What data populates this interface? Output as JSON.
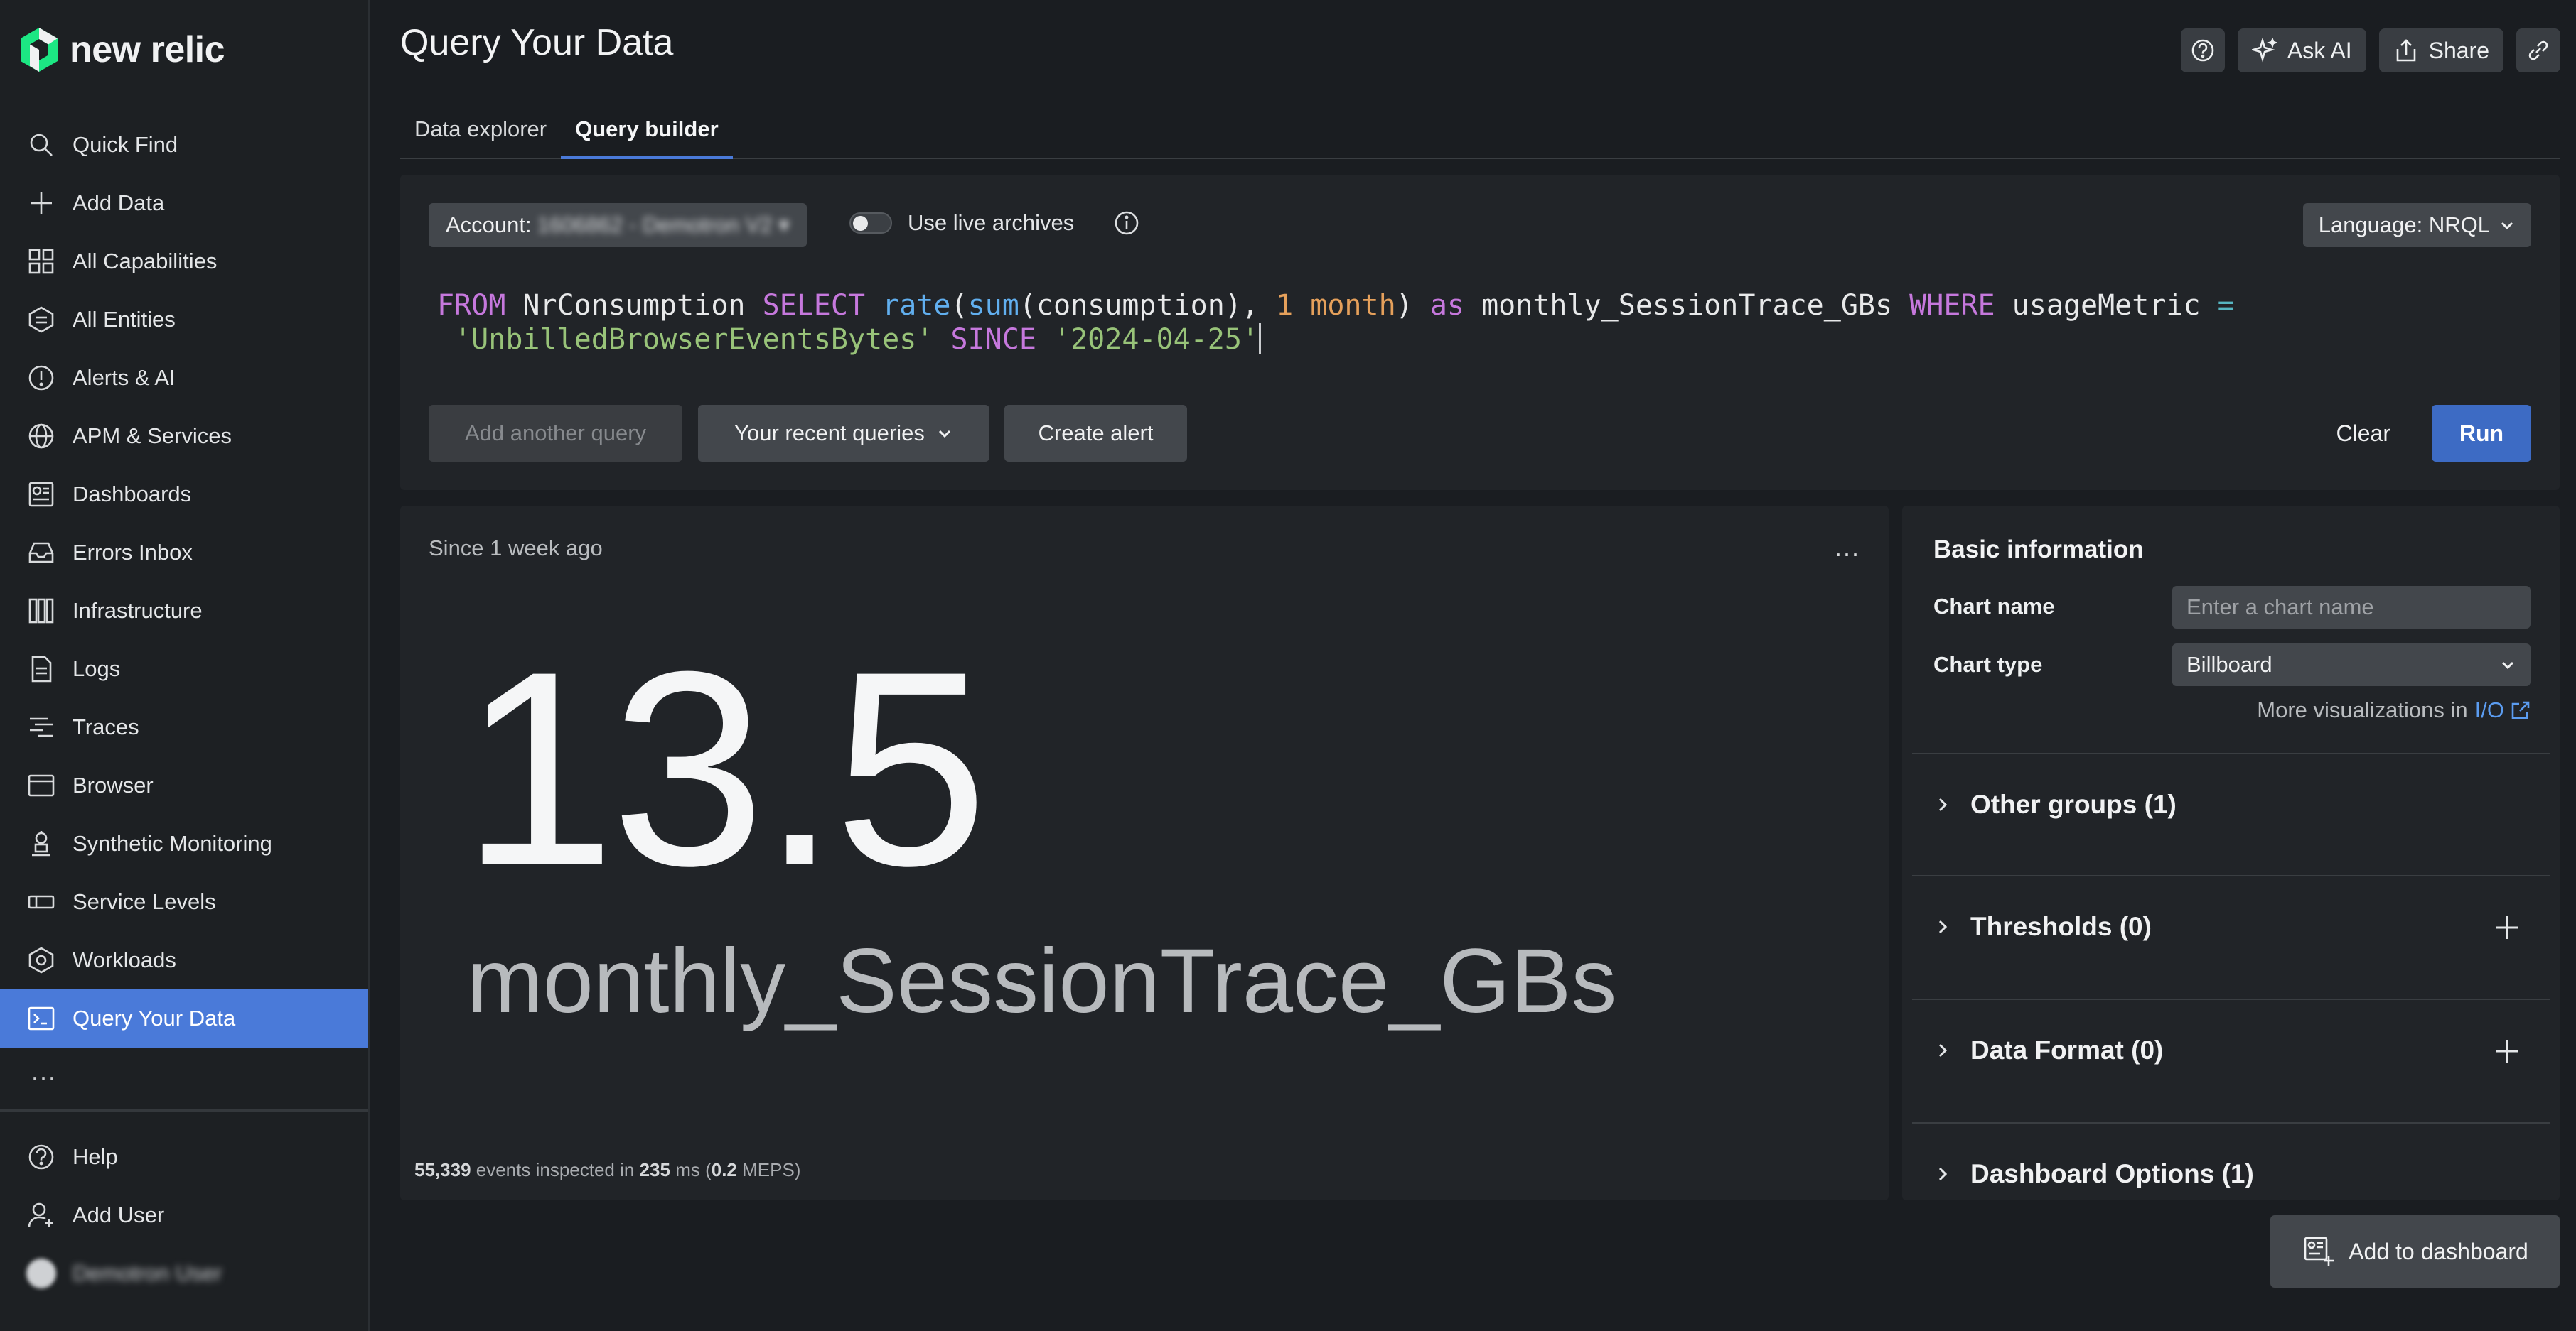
{
  "app": {
    "brand": "new relic"
  },
  "sidebar": {
    "items": [
      {
        "label": "Quick Find",
        "icon": "search-icon"
      },
      {
        "label": "Add Data",
        "icon": "plus-icon"
      },
      {
        "label": "All Capabilities",
        "icon": "grid-icon"
      },
      {
        "label": "All Entities",
        "icon": "entities-icon"
      },
      {
        "label": "Alerts & AI",
        "icon": "alert-icon"
      },
      {
        "label": "APM & Services",
        "icon": "globe-icon"
      },
      {
        "label": "Dashboards",
        "icon": "dashboard-icon"
      },
      {
        "label": "Errors Inbox",
        "icon": "inbox-icon"
      },
      {
        "label": "Infrastructure",
        "icon": "infrastructure-icon"
      },
      {
        "label": "Logs",
        "icon": "logs-icon"
      },
      {
        "label": "Traces",
        "icon": "traces-icon"
      },
      {
        "label": "Browser",
        "icon": "browser-icon"
      },
      {
        "label": "Synthetic Monitoring",
        "icon": "synthetic-icon"
      },
      {
        "label": "Service Levels",
        "icon": "service-levels-icon"
      },
      {
        "label": "Workloads",
        "icon": "workloads-icon"
      },
      {
        "label": "Query Your Data",
        "icon": "query-icon"
      }
    ],
    "more": "...",
    "bottom": {
      "help": "Help",
      "add_user": "Add User",
      "user_name": "Demotron User"
    }
  },
  "header": {
    "title": "Query Your Data",
    "ask_ai": "Ask AI",
    "share": "Share"
  },
  "tabs": [
    {
      "label": "Data explorer"
    },
    {
      "label": "Query builder"
    }
  ],
  "query": {
    "account_prefix": "Account:",
    "account_value": "1606862 - Demotron V2 ▾",
    "live_archives": "Use live archives",
    "language": "Language: NRQL",
    "nrql_text": "FROM NrConsumption SELECT rate(sum(consumption), 1 month) as monthly_SessionTrace_GBs WHERE usageMetric = 'UnbilledBrowserEventsBytes' SINCE '2024-04-25'",
    "tokens": {
      "t1": "FROM",
      "t2": " NrConsumption ",
      "t3": "SELECT",
      "t4": " ",
      "t5": "rate",
      "t6": "(",
      "t7": "sum",
      "t8": "(consumption), ",
      "t9": "1",
      "t10": " ",
      "t11": "month",
      "t12": ") ",
      "t13": "as",
      "t14": " monthly_SessionTrace_GBs ",
      "t15": "WHERE",
      "t16": " usageMetric ",
      "t17": "=",
      "t18": " ",
      "t19": "'UnbilledBrowserEventsBytes'",
      "t20": " ",
      "t21": "SINCE",
      "t22": " ",
      "t23": "'2024-04-25'"
    },
    "add_another": "Add another query",
    "recent": "Your recent queries",
    "create_alert": "Create alert",
    "clear": "Clear",
    "run": "Run"
  },
  "result": {
    "since": "Since 1 week ago",
    "more": "...",
    "value": "13.5",
    "metric": "monthly_SessionTrace_GBs",
    "events_count": "55,339",
    "events_mid": " events inspected in ",
    "duration": "235",
    "duration_unit": " ms (",
    "meps": "0.2",
    "meps_suffix": " MEPS)"
  },
  "settings": {
    "basic_info": "Basic information",
    "chart_name_label": "Chart name",
    "chart_name_placeholder": "Enter a chart name",
    "chart_type_label": "Chart type",
    "chart_type_value": "Billboard",
    "more_viz": "More visualizations in",
    "more_viz_link": "I/O",
    "sections": [
      {
        "label": "Other groups (1)"
      },
      {
        "label": "Thresholds (0)"
      },
      {
        "label": "Data Format (0)"
      },
      {
        "label": "Dashboard Options (1)"
      }
    ]
  },
  "footer": {
    "add_to_dashboard": "Add to dashboard"
  },
  "colors": {
    "accent": "#4a7ad9",
    "run_button": "#3d6bc4",
    "background": "#1a1d21",
    "panel": "#212428"
  }
}
